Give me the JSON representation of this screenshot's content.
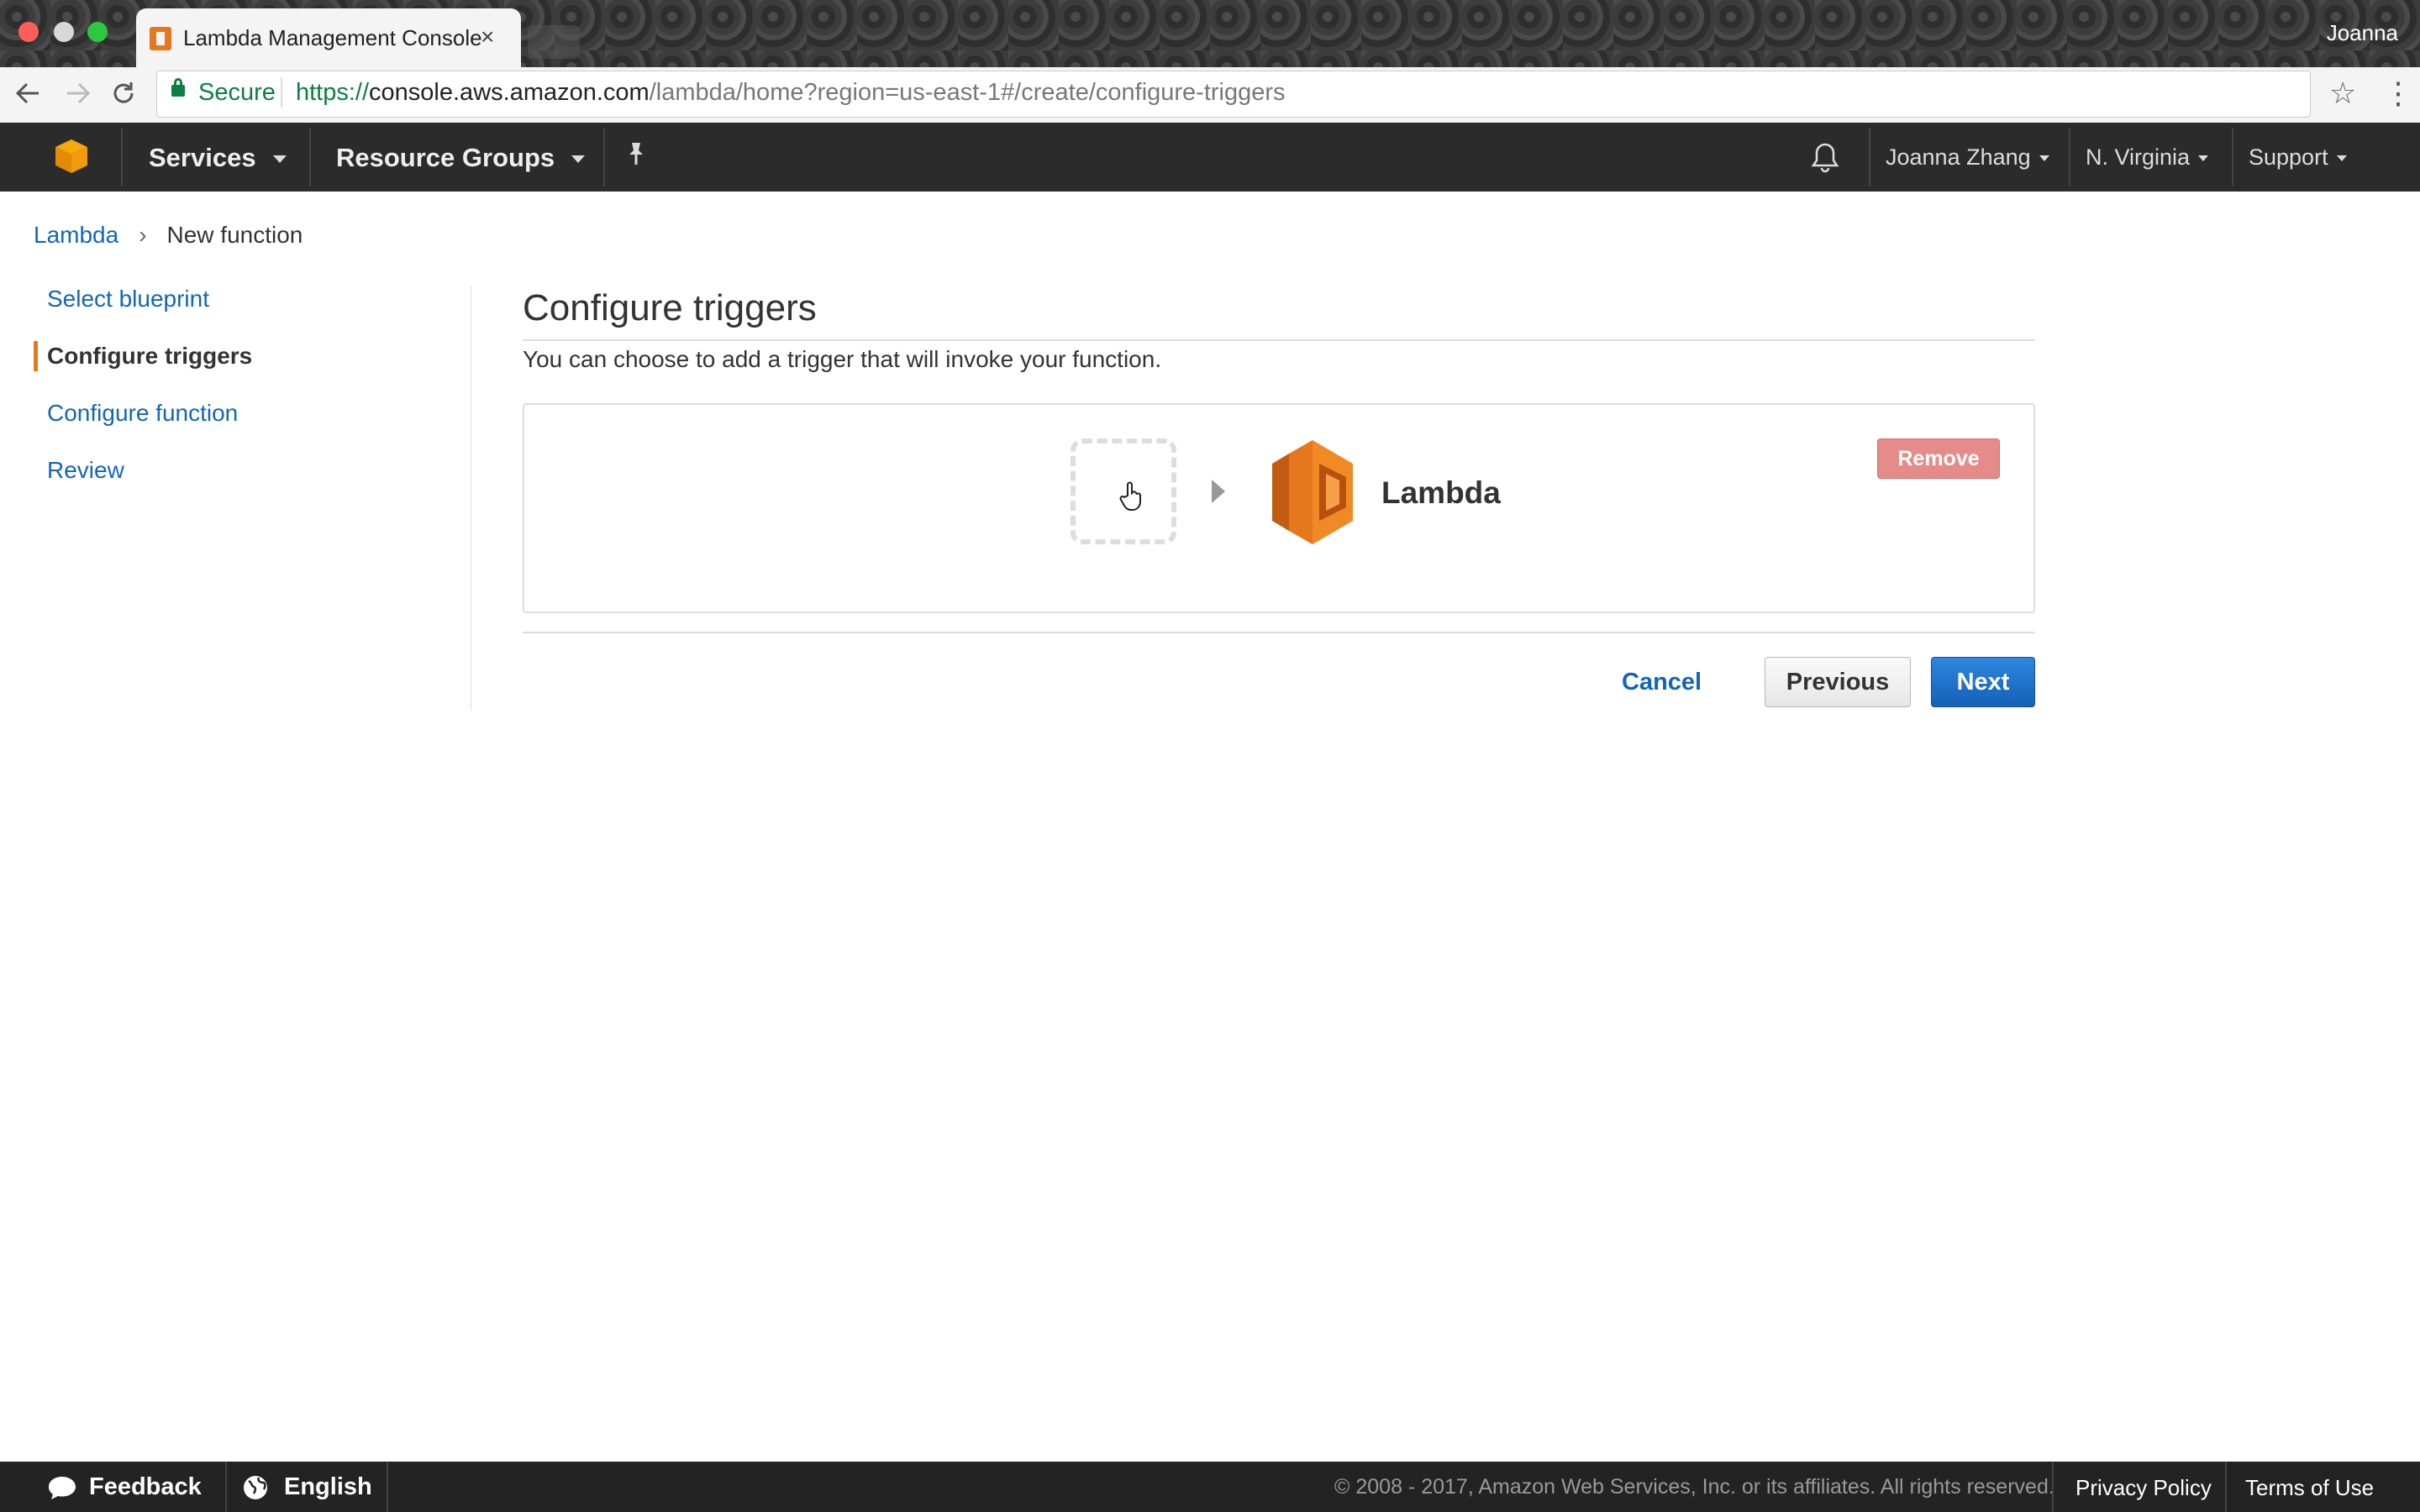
{
  "browser": {
    "tab_title": "Lambda Management Console",
    "tab_close": "×",
    "profile_name": "Joanna",
    "secure_label": "Secure",
    "url_scheme": "https://",
    "url_host": "console.aws.amazon.com",
    "url_path": "/lambda/home?region=us-east-1#/create/configure-triggers"
  },
  "aws_nav": {
    "services": "Services",
    "resource_groups": "Resource Groups",
    "user": "Joanna Zhang",
    "region": "N. Virginia",
    "support": "Support"
  },
  "breadcrumb": {
    "root": "Lambda",
    "current": "New function"
  },
  "sidebar": {
    "items": [
      {
        "label": "Select blueprint",
        "active": false
      },
      {
        "label": "Configure triggers",
        "active": true
      },
      {
        "label": "Configure function",
        "active": false
      },
      {
        "label": "Review",
        "active": false
      }
    ]
  },
  "main": {
    "title": "Configure triggers",
    "subtitle": "You can choose to add a trigger that will invoke your function.",
    "target_label": "Lambda",
    "remove_label": "Remove",
    "cancel_label": "Cancel",
    "previous_label": "Previous",
    "next_label": "Next"
  },
  "footer": {
    "feedback": "Feedback",
    "language": "English",
    "copyright": "© 2008 - 2017, Amazon Web Services, Inc. or its affiliates. All rights reserved.",
    "privacy": "Privacy Policy",
    "terms": "Terms of Use"
  },
  "colors": {
    "accent": "#e5771e",
    "link": "#1166bb",
    "primary_button": "#1f6fc9",
    "nav_background": "#2b2b2b"
  }
}
